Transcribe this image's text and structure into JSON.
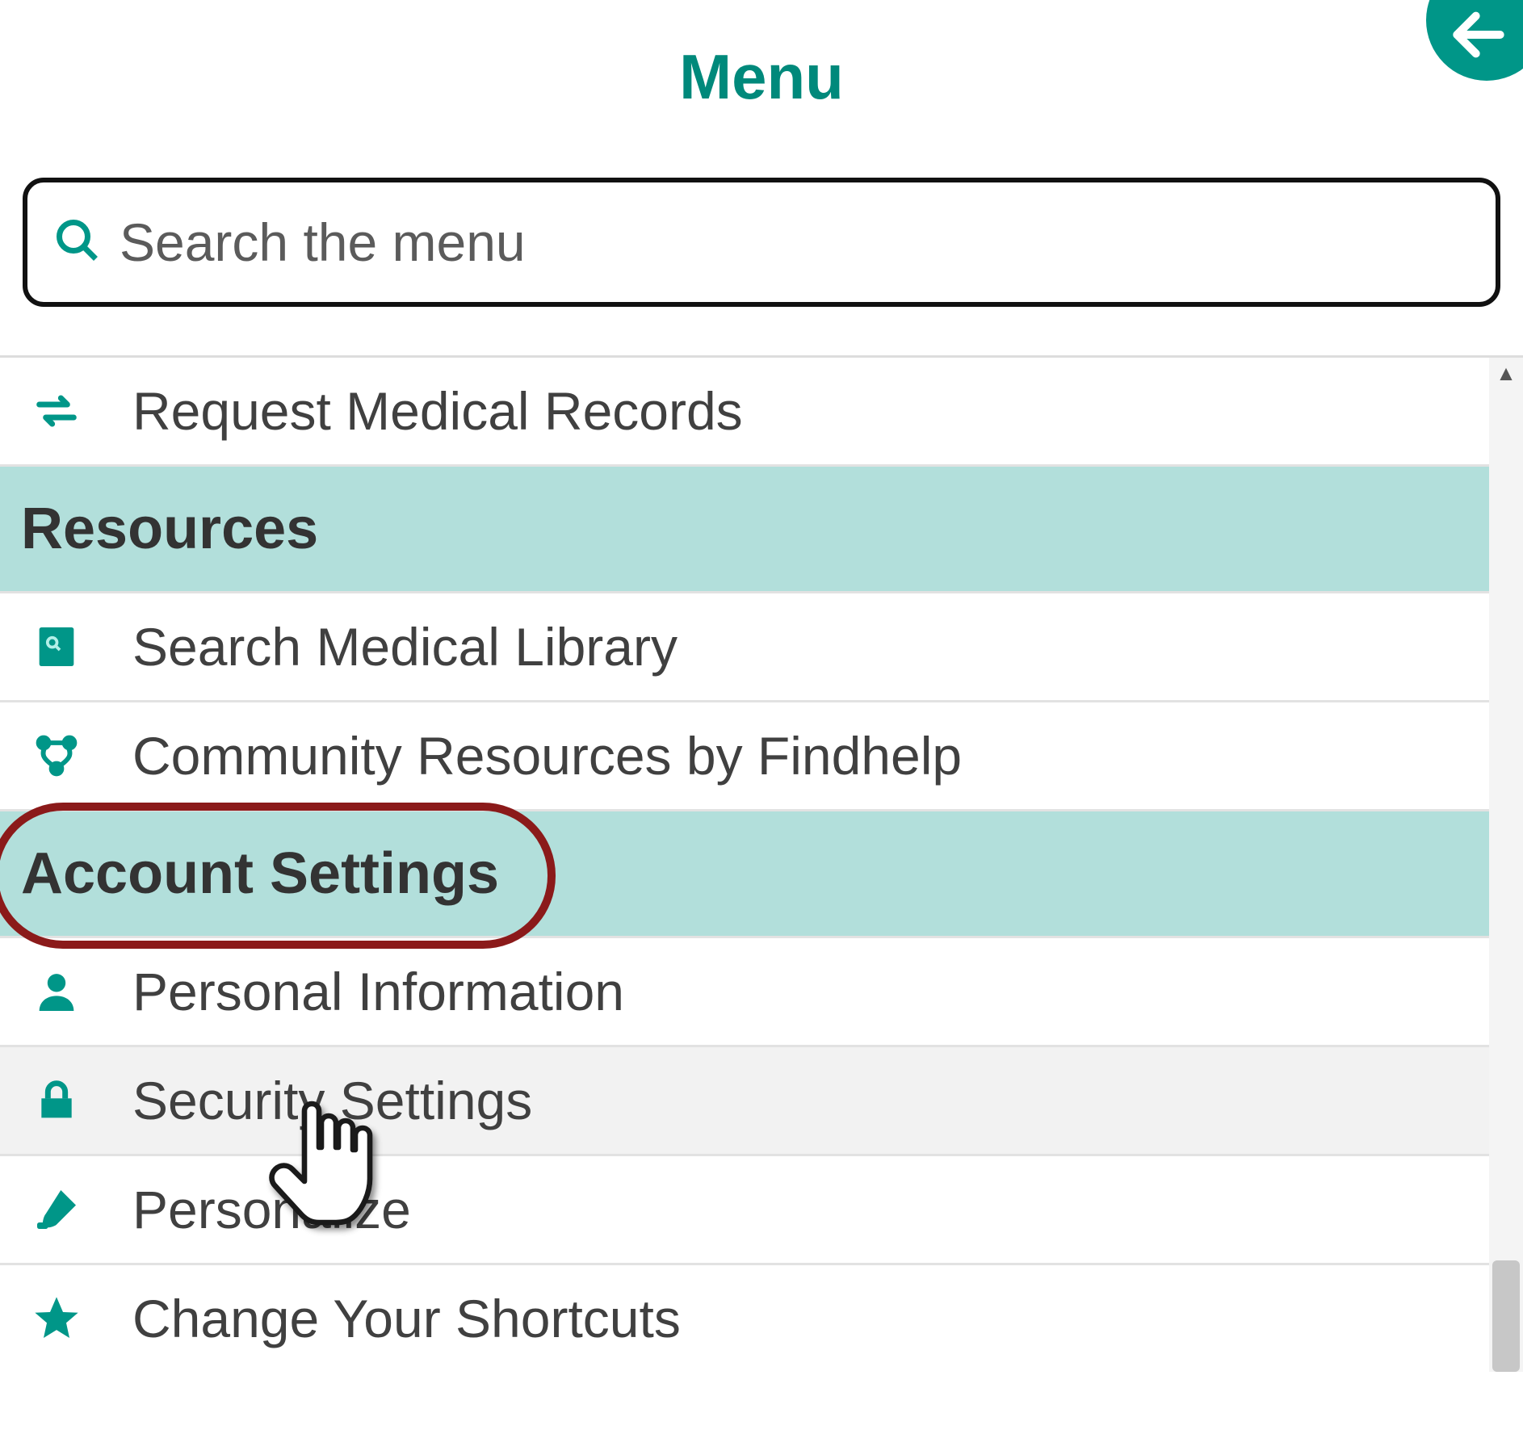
{
  "header": {
    "title": "Menu"
  },
  "search": {
    "placeholder": "Search the menu",
    "value": ""
  },
  "top_item": {
    "label": "Request Medical Records",
    "icon": "swap-icon"
  },
  "sections": [
    {
      "title": "Resources",
      "highlighted": false,
      "items": [
        {
          "label": "Search Medical Library",
          "icon": "book-icon"
        },
        {
          "label": "Community Resources by Findhelp",
          "icon": "network-icon"
        }
      ]
    },
    {
      "title": "Account Settings",
      "highlighted": true,
      "items": [
        {
          "label": "Personal Information",
          "icon": "person-icon"
        },
        {
          "label": "Security Settings",
          "icon": "lock-icon",
          "hovered": true,
          "cursor_target": true
        },
        {
          "label": "Personalize",
          "icon": "brush-icon",
          "partial": true
        },
        {
          "label": "Change Your Shortcuts",
          "icon": "star-icon",
          "partial": true
        }
      ]
    }
  ],
  "colors": {
    "accent": "#009688",
    "section_bg": "#b2dfdb",
    "highlight_ring": "#8b1a1a"
  },
  "scrollbar": {
    "thumb_top_pct": 89,
    "thumb_height_pct": 11
  }
}
